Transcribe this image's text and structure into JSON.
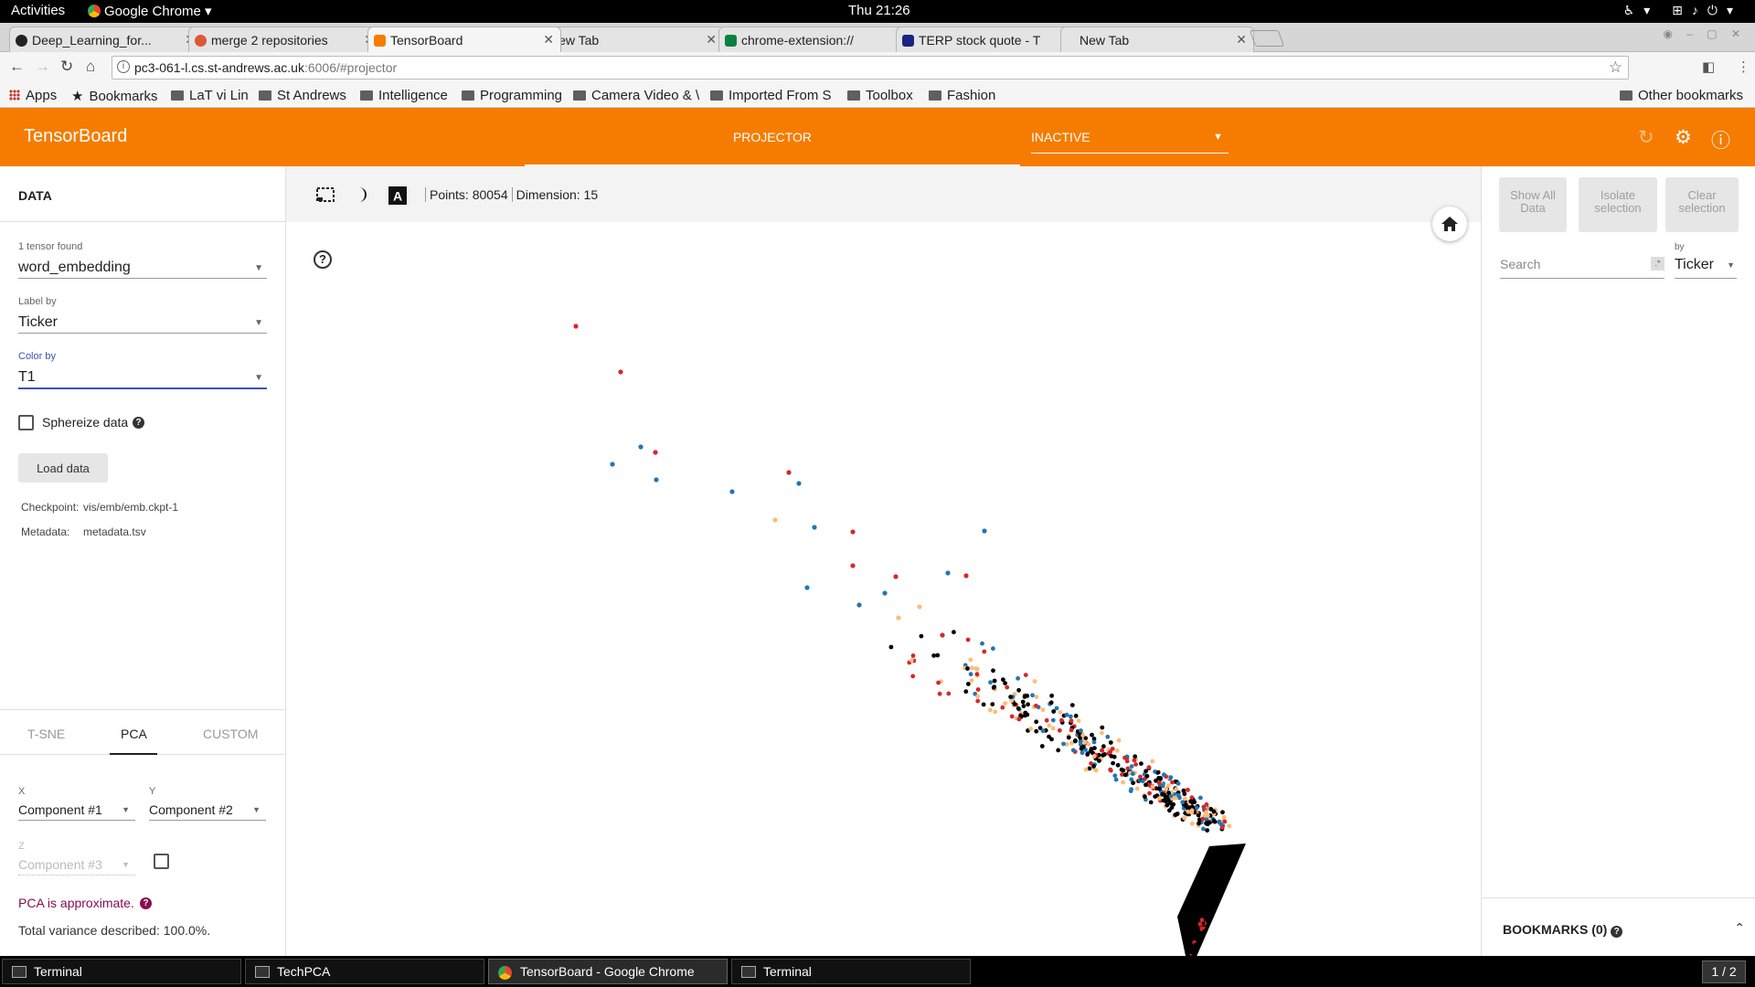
{
  "system": {
    "activities": "Activities",
    "app_name": "Google Chrome",
    "clock": "Thu 21:26",
    "tray_icons": [
      "accessibility-icon",
      "network-icon",
      "volume-icon",
      "power-icon"
    ]
  },
  "browser": {
    "tabs": [
      {
        "title": "Deep_Learning_for...",
        "icon": "github-icon",
        "active": false
      },
      {
        "title": "merge 2 repositories",
        "icon": "duckduckgo-icon",
        "active": false
      },
      {
        "title": "TensorBoard",
        "icon": "tensorboard-icon",
        "active": true
      },
      {
        "title": "New Tab",
        "icon": "",
        "active": false
      },
      {
        "title": "chrome-extension://",
        "icon": "extension-icon",
        "active": false
      },
      {
        "title": "TERP stock quote - T",
        "icon": "chart-icon",
        "active": false
      },
      {
        "title": "New Tab",
        "icon": "",
        "active": false
      }
    ],
    "url_host": "pc3-061-l.cs.st-andrews.ac.uk",
    "url_rest": ":6006/#projector",
    "bookmarks": [
      {
        "label": "Apps",
        "type": "apps"
      },
      {
        "label": "Bookmarks",
        "type": "star"
      },
      {
        "label": "LaT vi Lin",
        "type": "folder"
      },
      {
        "label": "St Andrews",
        "type": "folder"
      },
      {
        "label": "Intelligence",
        "type": "folder"
      },
      {
        "label": "Programming",
        "type": "folder"
      },
      {
        "label": "Camera Video & \\",
        "type": "folder"
      },
      {
        "label": "Imported From S",
        "type": "folder"
      },
      {
        "label": "Toolbox",
        "type": "folder"
      },
      {
        "label": "Fashion",
        "type": "folder"
      }
    ],
    "other_bookmarks": "Other bookmarks"
  },
  "tensorboard": {
    "brand": "TensorBoard",
    "plugin_tab": "PROJECTOR",
    "inactive_dropdown": "INACTIVE",
    "accent_color": "#f57c00"
  },
  "left": {
    "data_header": "DATA",
    "tensor_label": "1 tensor found",
    "tensor_value": "word_embedding",
    "label_by_label": "Label by",
    "label_by_value": "Ticker",
    "color_by_label": "Color by",
    "color_by_value": "T1",
    "sphereize": "Sphereize data",
    "load_button": "Load data",
    "checkpoint_key": "Checkpoint:",
    "checkpoint_val": "vis/emb/emb.ckpt-1",
    "metadata_key": "Metadata:",
    "metadata_val": "metadata.tsv",
    "proj_tabs": [
      "T-SNE",
      "PCA",
      "CUSTOM"
    ],
    "x_label": "X",
    "x_value": "Component #1",
    "y_label": "Y",
    "y_value": "Component #2",
    "z_label": "Z",
    "z_value": "Component #3",
    "pca_note": "PCA is approximate.",
    "variance": "Total variance described: 100.0%."
  },
  "center": {
    "points_text": "Points: 80054",
    "dimension_text": "Dimension: 15",
    "point_colors": [
      "#d62728",
      "#1f77b4",
      "#ffbb78",
      "#000000"
    ]
  },
  "right": {
    "show_all": "Show All Data",
    "isolate": "Isolate selection",
    "clear": "Clear selection",
    "search_placeholder": "Search",
    "regex_icon": ".*",
    "by_label": "by",
    "by_value": "Ticker",
    "bookmarks_label": "BOOKMARKS (0)"
  },
  "taskbar": {
    "items": [
      {
        "label": "Terminal",
        "icon": "terminal-icon",
        "active": false
      },
      {
        "label": "TechPCA",
        "icon": "window-icon",
        "active": false
      },
      {
        "label": "TensorBoard - Google Chrome",
        "icon": "chrome-icon",
        "active": true
      },
      {
        "label": "Terminal",
        "icon": "terminal-icon",
        "active": false
      }
    ],
    "workspace": "1 / 2"
  }
}
